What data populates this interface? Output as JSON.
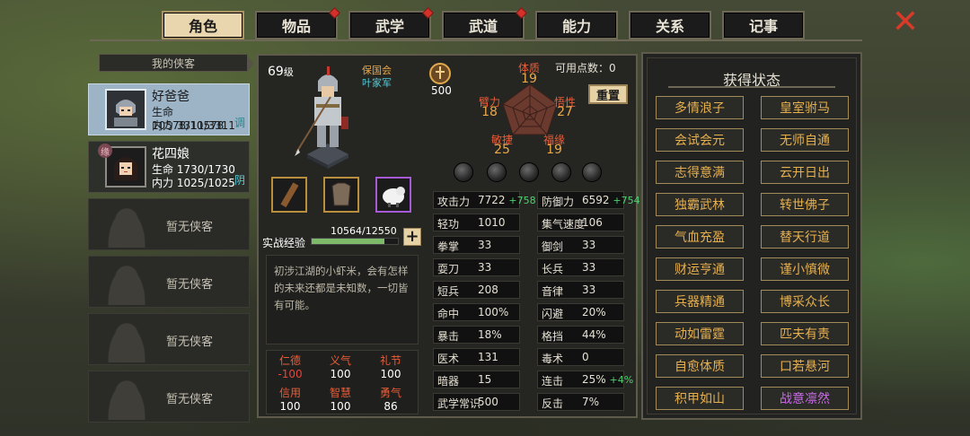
{
  "tabs": [
    {
      "label": "角色",
      "active": true,
      "alert": false
    },
    {
      "label": "物品",
      "active": false,
      "alert": true
    },
    {
      "label": "武学",
      "active": false,
      "alert": true
    },
    {
      "label": "武道",
      "active": false,
      "alert": true
    },
    {
      "label": "能力",
      "active": false,
      "alert": false
    },
    {
      "label": "关系",
      "active": false,
      "alert": false
    },
    {
      "label": "记事",
      "active": false,
      "alert": false
    }
  ],
  "close_icon": "✕",
  "roster": {
    "header": "我的侠客",
    "heroes": [
      {
        "name": "好爸爸",
        "hp": "生命 10578/10578",
        "mp": "内力 3311/3311",
        "tag": "调",
        "selected": true
      },
      {
        "name": "花四娘",
        "hp": "生命 1730/1730",
        "mp": "内力 1025/1025",
        "tag": "阴",
        "selected": false,
        "badge": "缘"
      }
    ],
    "empty_label": "暂无侠客"
  },
  "character": {
    "level": "69",
    "level_unit": "级",
    "faction": "保国会",
    "faction_role": "叶家军",
    "fame": "500",
    "available_points_label": "可用点数：",
    "available_points": "0",
    "reset_label": "重置",
    "attributes": {
      "physique": {
        "label": "体质",
        "value": "19"
      },
      "arm_strength": {
        "label": "臂力",
        "value": "18"
      },
      "insight": {
        "label": "悟性",
        "value": "27"
      },
      "agility": {
        "label": "敏捷",
        "value": "25"
      },
      "fortune": {
        "label": "福缘",
        "value": "19"
      }
    },
    "exp_label": "实战经验",
    "exp_value": "10564/12550",
    "exp_ratio": 0.8417,
    "description": "初涉江湖的小虾米，会有怎样的未来还都是未知数，一切皆有可能。",
    "virtues": [
      {
        "name": "仁德",
        "value": "-100",
        "negative": true
      },
      {
        "name": "义气",
        "value": "100",
        "negative": false
      },
      {
        "name": "礼节",
        "value": "100",
        "negative": false
      },
      {
        "name": "信用",
        "value": "100",
        "negative": false
      },
      {
        "name": "智慧",
        "value": "100",
        "negative": false
      },
      {
        "name": "勇气",
        "value": "86",
        "negative": false
      }
    ]
  },
  "stats_left": [
    {
      "k": "攻击力",
      "v": "7722",
      "bonus": "+758"
    },
    {
      "k": "轻功",
      "v": "1010",
      "bonus": ""
    },
    {
      "k": "拳掌",
      "v": "33",
      "bonus": ""
    },
    {
      "k": "耍刀",
      "v": "33",
      "bonus": ""
    },
    {
      "k": "短兵",
      "v": "208",
      "bonus": ""
    },
    {
      "k": "命中",
      "v": "100%",
      "bonus": ""
    },
    {
      "k": "暴击",
      "v": "18%",
      "bonus": ""
    },
    {
      "k": "医术",
      "v": "131",
      "bonus": ""
    },
    {
      "k": "暗器",
      "v": "15",
      "bonus": ""
    },
    {
      "k": "武学常识",
      "v": "500",
      "bonus": ""
    }
  ],
  "stats_right": [
    {
      "k": "防御力",
      "v": "6592",
      "bonus": "+754"
    },
    {
      "k": "集气速度",
      "v": "106",
      "bonus": ""
    },
    {
      "k": "御剑",
      "v": "33",
      "bonus": ""
    },
    {
      "k": "长兵",
      "v": "33",
      "bonus": ""
    },
    {
      "k": "音律",
      "v": "33",
      "bonus": ""
    },
    {
      "k": "闪避",
      "v": "20%",
      "bonus": ""
    },
    {
      "k": "格挡",
      "v": "44%",
      "bonus": ""
    },
    {
      "k": "毒术",
      "v": "0",
      "bonus": ""
    },
    {
      "k": "连击",
      "v": "25%",
      "bonus": "+4%"
    },
    {
      "k": "反击",
      "v": "7%",
      "bonus": ""
    }
  ],
  "status_panel": {
    "title": "获得状态",
    "items": [
      {
        "label": "多情浪子",
        "color": "gold"
      },
      {
        "label": "皇室驸马",
        "color": "gold"
      },
      {
        "label": "会试会元",
        "color": "gold"
      },
      {
        "label": "无师自通",
        "color": "gold"
      },
      {
        "label": "志得意满",
        "color": "gold"
      },
      {
        "label": "云开日出",
        "color": "gold"
      },
      {
        "label": "独霸武林",
        "color": "gold"
      },
      {
        "label": "转世佛子",
        "color": "gold"
      },
      {
        "label": "气血充盈",
        "color": "gold"
      },
      {
        "label": "替天行道",
        "color": "gold"
      },
      {
        "label": "财运亨通",
        "color": "gold"
      },
      {
        "label": "谨小慎微",
        "color": "gold"
      },
      {
        "label": "兵器精通",
        "color": "gold"
      },
      {
        "label": "博采众长",
        "color": "gold"
      },
      {
        "label": "动如雷霆",
        "color": "gold"
      },
      {
        "label": "匹夫有责",
        "color": "gold"
      },
      {
        "label": "自愈体质",
        "color": "gold"
      },
      {
        "label": "口若悬河",
        "color": "gold"
      },
      {
        "label": "积甲如山",
        "color": "gold"
      },
      {
        "label": "战意凛然",
        "color": "purple"
      }
    ]
  }
}
